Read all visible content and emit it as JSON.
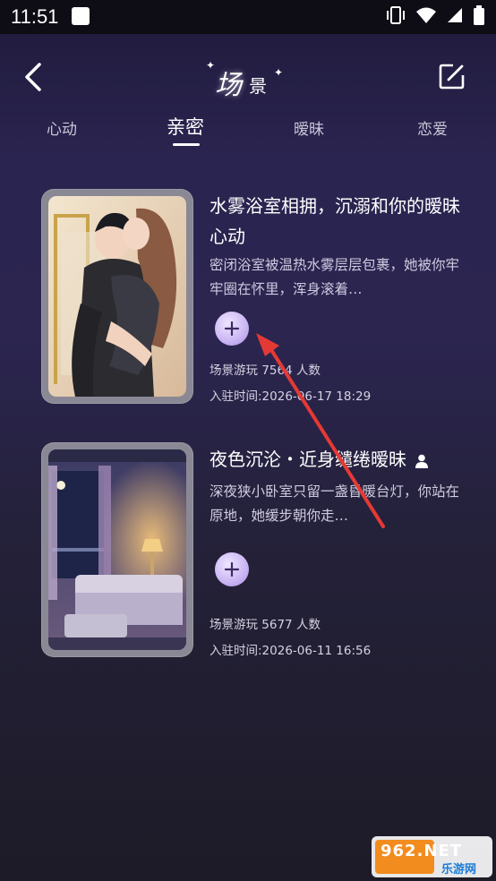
{
  "status_bar": {
    "time": "11:51"
  },
  "header": {
    "title_main": "场",
    "title_sub": "景"
  },
  "tabs": [
    {
      "label": "心动",
      "active": false
    },
    {
      "label": "亲密",
      "active": true
    },
    {
      "label": "暧昧",
      "active": false
    },
    {
      "label": "恋爱",
      "active": false
    }
  ],
  "cards": [
    {
      "title": "水雾浴室相拥，沉溺和你的暧昧心动",
      "description": "密闭浴室被温热水雾层层包裹，她被你牢牢圈在怀里，浑身滚着…",
      "plays": "场景游玩 7564 人数",
      "joined": "入驻时间:2026-06-17 18:29"
    },
    {
      "title": "夜色沉沦・近身缱绻暧昧",
      "description": "深夜狭小卧室只留一盏昏暖台灯，你站在原地，她缓步朝你走…",
      "plays": "场景游玩 5677 人数",
      "joined": "入驻时间:2026-06-11 16:56"
    }
  ],
  "watermark": {
    "brand": "962.NET",
    "sub": "乐游网"
  },
  "colors": {
    "accent_plus": "#c9b5f3",
    "arrow": "#e53935",
    "bg_top": "#2a2450",
    "bg_bottom": "#1d1b27"
  }
}
